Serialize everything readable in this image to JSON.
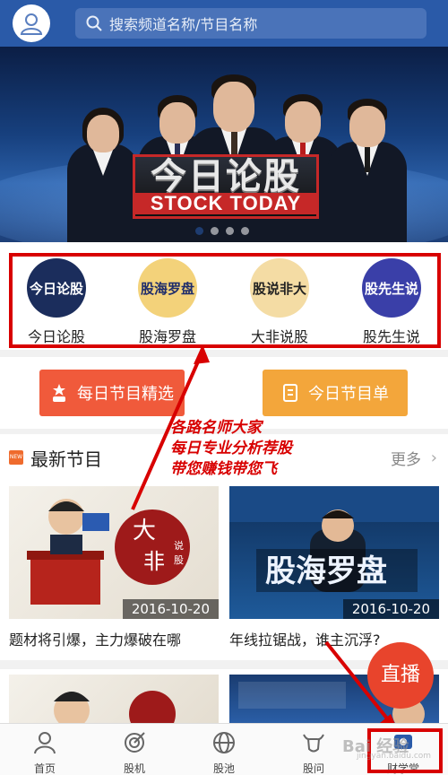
{
  "search": {
    "placeholder": "搜索频道名称/节目名称"
  },
  "banner": {
    "logo_zh": "今日论股",
    "logo_en": "STOCK TODAY"
  },
  "channels": [
    {
      "label": "今日论股",
      "logo_text": "今日论股",
      "bg": "#1b2d5c",
      "fg": "#ffffff"
    },
    {
      "label": "股海罗盘",
      "logo_text": "股海罗盘",
      "bg": "#f3d27a",
      "fg": "#1f2d6b"
    },
    {
      "label": "大非说股",
      "logo_text": "股说非大",
      "bg": "#f4dca4",
      "fg": "#222222"
    },
    {
      "label": "股先生说",
      "logo_text": "股先生说",
      "bg": "#3a3fa8",
      "fg": "#ffffff"
    }
  ],
  "buttons": {
    "daily_pick": "每日节目精选",
    "today_list": "今日节目单"
  },
  "section": {
    "title": "最新节目",
    "more": "更多",
    "badge": "NEW"
  },
  "cards": [
    {
      "date": "2016-10-20",
      "title": "题材将引爆，主力爆破在哪",
      "art_text": "大非说股"
    },
    {
      "date": "2016-10-20",
      "title": "年线拉锯战，谁主沉浮?",
      "art_text": "股海罗盘"
    }
  ],
  "annotation": {
    "line1": "各路名师大家",
    "line2": "每日专业分析荐股",
    "line3": "带您赚钱带您飞"
  },
  "live": {
    "label": "直播"
  },
  "tabs": [
    {
      "label": "首页",
      "icon": "home-people-icon"
    },
    {
      "label": "股机",
      "icon": "target-icon"
    },
    {
      "label": "股池",
      "icon": "globe-icon"
    },
    {
      "label": "股问",
      "icon": "bull-icon"
    },
    {
      "label": "财学堂",
      "icon": "class-icon"
    }
  ],
  "watermark": {
    "line1": "Bai 经验",
    "line2": "jingyan.baidu.com"
  },
  "colors": {
    "brand_blue": "#2a5aa8",
    "highlight_red": "#d80000",
    "btn_red": "#f05a3b",
    "btn_yellow": "#f3a63b"
  }
}
